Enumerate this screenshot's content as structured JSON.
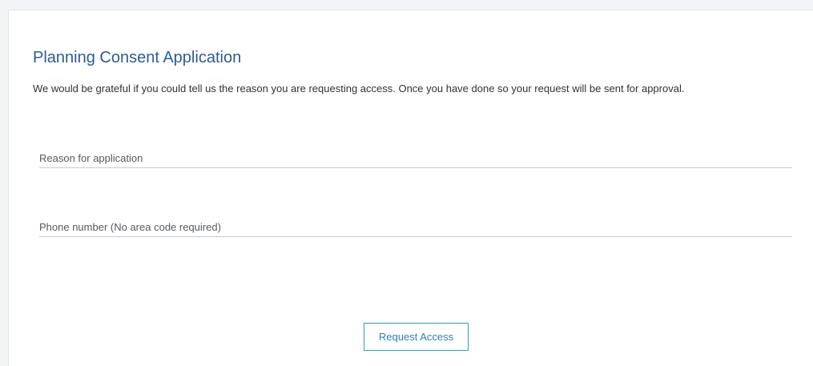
{
  "form": {
    "title": "Planning Consent Application",
    "intro": "We would be grateful if you could tell us the reason you are requesting access. Once you have done so your request will be sent for approval.",
    "reason": {
      "placeholder": "Reason for application",
      "value": ""
    },
    "phone": {
      "placeholder": "Phone number (No area code required)",
      "value": ""
    },
    "submit_label": "Request Access"
  },
  "colors": {
    "title": "#2d5b9a",
    "button_border": "#2e9ad0",
    "button_text": "#2e7fb8"
  }
}
